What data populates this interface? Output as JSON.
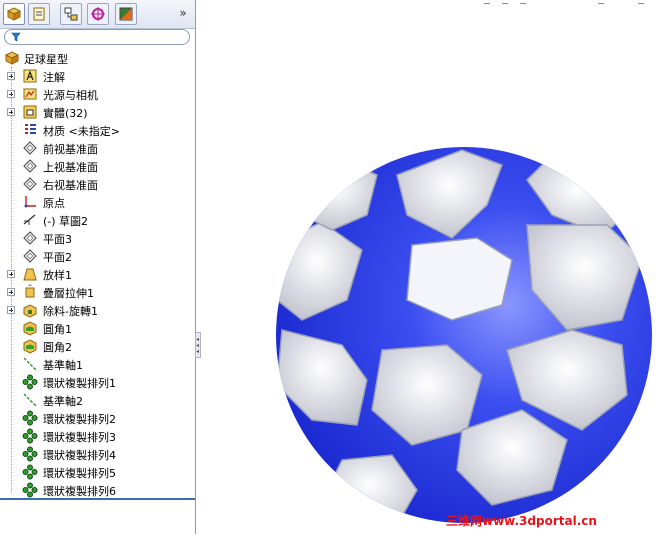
{
  "feature_tree": {
    "root": "足球星型",
    "items": [
      {
        "label": "注解",
        "icon": "annotation-icon",
        "expandable": true
      },
      {
        "label": "光源与相机",
        "icon": "lights-cameras-icon",
        "expandable": true
      },
      {
        "label": "實體(32)",
        "icon": "solid-bodies-icon",
        "expandable": true
      },
      {
        "label": "材质 <未指定>",
        "icon": "material-icon",
        "expandable": false
      },
      {
        "label": "前视基准面",
        "icon": "plane-icon",
        "expandable": false
      },
      {
        "label": "上视基准面",
        "icon": "plane-icon",
        "expandable": false
      },
      {
        "label": "右视基准面",
        "icon": "plane-icon",
        "expandable": false
      },
      {
        "label": "原点",
        "icon": "origin-icon",
        "expandable": false
      },
      {
        "label": "(-) 草圖2",
        "icon": "sketch-icon",
        "expandable": false
      },
      {
        "label": "平面3",
        "icon": "plane-icon",
        "expandable": false
      },
      {
        "label": "平面2",
        "icon": "plane-icon",
        "expandable": false
      },
      {
        "label": "放样1",
        "icon": "loft-icon",
        "expandable": true
      },
      {
        "label": "疊層拉伸1",
        "icon": "extrude-icon",
        "expandable": true
      },
      {
        "label": "除料-旋轉1",
        "icon": "revolve-cut-icon",
        "expandable": true
      },
      {
        "label": "圓角1",
        "icon": "fillet-icon",
        "expandable": false
      },
      {
        "label": "圓角2",
        "icon": "fillet-icon",
        "expandable": false
      },
      {
        "label": "基準軸1",
        "icon": "axis-icon",
        "expandable": false
      },
      {
        "label": "環狀複製排列1",
        "icon": "circular-pattern-icon",
        "expandable": false
      },
      {
        "label": "基準軸2",
        "icon": "axis-icon",
        "expandable": false
      },
      {
        "label": "環狀複製排列2",
        "icon": "circular-pattern-icon",
        "expandable": false
      },
      {
        "label": "環狀複製排列3",
        "icon": "circular-pattern-icon",
        "expandable": false
      },
      {
        "label": "環狀複製排列4",
        "icon": "circular-pattern-icon",
        "expandable": false
      },
      {
        "label": "環狀複製排列5",
        "icon": "circular-pattern-icon",
        "expandable": false
      },
      {
        "label": "環狀複製排列6",
        "icon": "circular-pattern-icon",
        "expandable": false
      }
    ]
  },
  "tabs": [
    {
      "name": "featuremanager-tab",
      "active": true
    },
    {
      "name": "propertymanager-tab",
      "active": false
    },
    {
      "name": "configurationmanager-tab",
      "active": false
    },
    {
      "name": "dimxpert-tab",
      "active": false
    },
    {
      "name": "display-manager-tab",
      "active": false
    }
  ],
  "expand_glyph": "»",
  "watermark": "三维网www.3dportal.cn",
  "colors": {
    "ball_blue": "#1a2fd6",
    "ball_white": "#dcdde6",
    "tree_accent": "#3a6db5",
    "watermark": "#e8141b"
  }
}
